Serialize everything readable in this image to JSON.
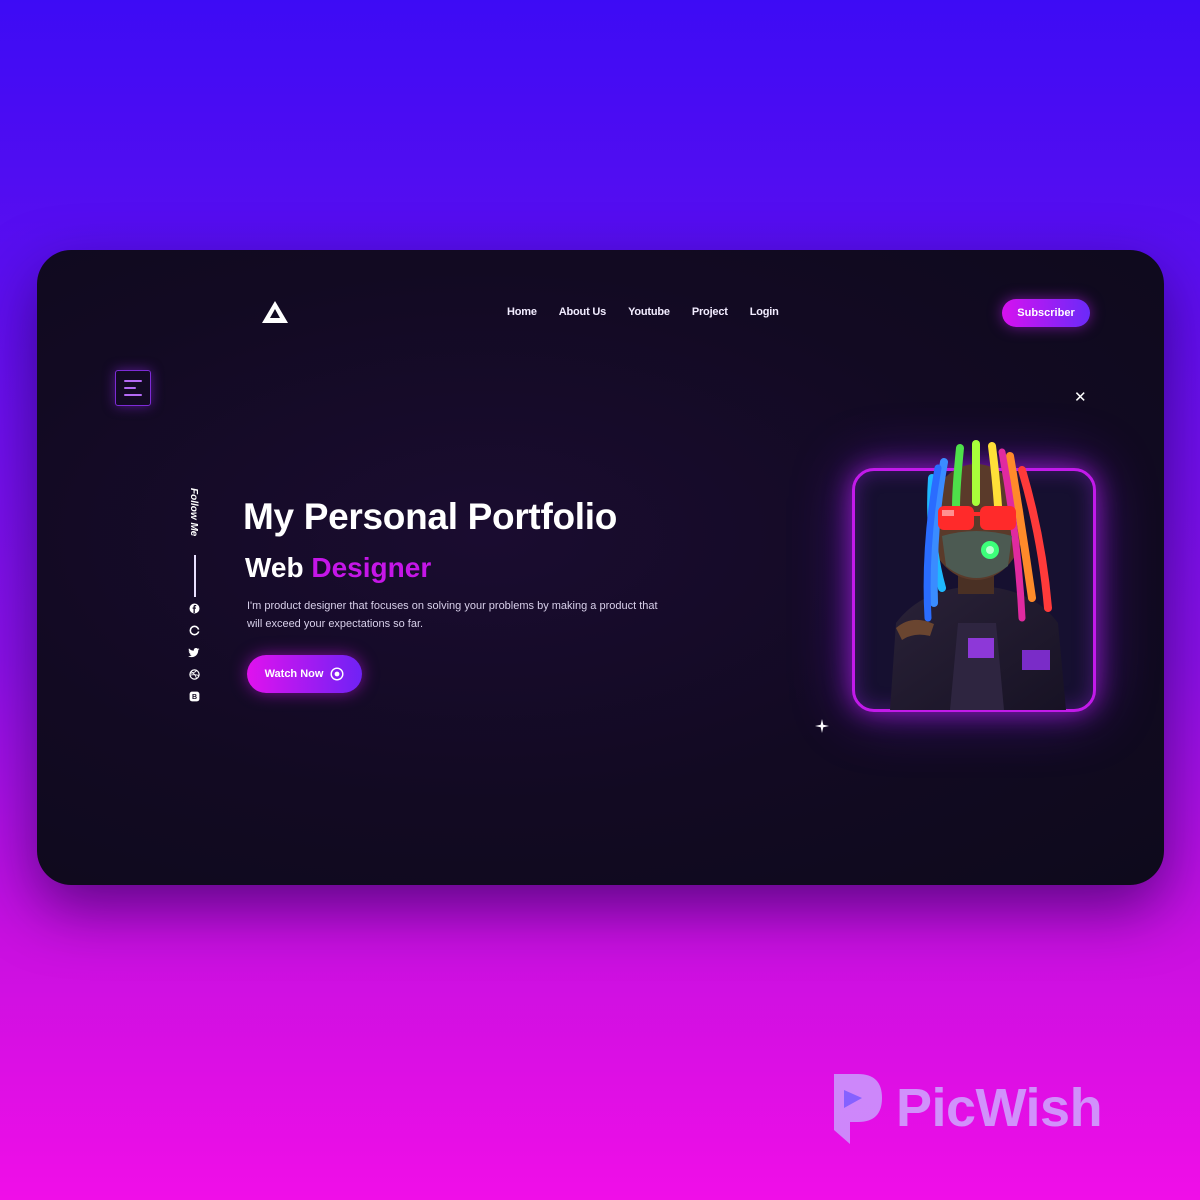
{
  "nav": {
    "items": [
      "Home",
      "About Us",
      "Youtube",
      "Project",
      "Login"
    ],
    "subscribe_label": "Subscriber"
  },
  "sidebar": {
    "follow_label": "Follow Me",
    "socials": [
      "facebook-icon",
      "github-icon",
      "twitter-icon",
      "dribbble-icon",
      "behance-icon"
    ]
  },
  "hero": {
    "title": "My Personal Portfolio",
    "subtitle_word1": "Web",
    "subtitle_word2": "Designer",
    "description": "I'm product designer that focuses on solving your problems by making a product that will exceed your expectations so far.",
    "cta_label": "Watch Now"
  },
  "watermark": {
    "text": "PicWish"
  },
  "colors": {
    "accent_pink": "#c516e8",
    "accent_violet": "#6f22f5",
    "card_bg": "#120a22"
  }
}
